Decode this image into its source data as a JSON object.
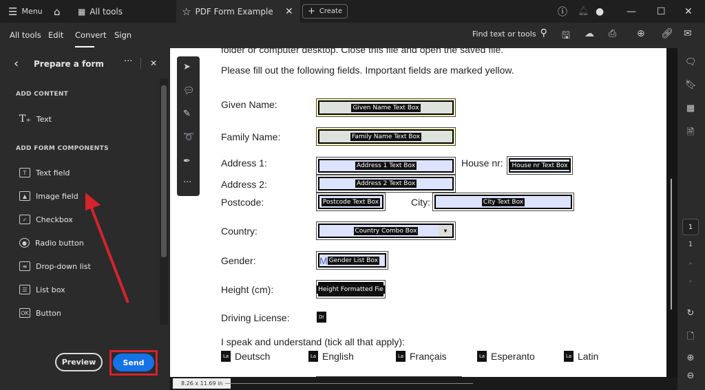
{
  "titlebar": {
    "menu": "Menu",
    "all_tools": "All tools",
    "tab_title": "PDF Form Example",
    "create": "Create"
  },
  "toolbar": {
    "nav": [
      "All tools",
      "Edit",
      "Convert",
      "Sign"
    ],
    "active": "Convert",
    "search": "Find text or tools"
  },
  "panel": {
    "title": "Prepare a form",
    "sections": [
      {
        "heading": "ADD CONTENT",
        "items": [
          {
            "label": "Text",
            "icon": "text-add-icon"
          }
        ]
      },
      {
        "heading": "ADD FORM COMPONENTS",
        "items": [
          {
            "label": "Text field",
            "icon": "text-field-icon"
          },
          {
            "label": "Image field",
            "icon": "image-icon"
          },
          {
            "label": "Checkbox",
            "icon": "checkbox-icon"
          },
          {
            "label": "Radio button",
            "icon": "radio-icon"
          },
          {
            "label": "Drop-down list",
            "icon": "dropdown-icon"
          },
          {
            "label": "List box",
            "icon": "listbox-icon"
          },
          {
            "label": "Button",
            "icon": "ok-button-icon"
          }
        ]
      }
    ],
    "preview": "Preview",
    "send": "Send",
    "send_color": "#1473e6",
    "highlight_color": "#d7232b"
  },
  "document": {
    "top_text": "folder or computer desktop. Close this file and open the saved file.",
    "intro": "Please fill out the following fields. Important fields are marked yellow.",
    "labels": {
      "given": "Given Name:",
      "family": "Family Name:",
      "addr1": "Address 1:",
      "house": "House nr:",
      "addr2": "Address 2:",
      "postcode": "Postcode:",
      "city": "City:",
      "country": "Country:",
      "gender": "Gender:",
      "height": "Height (cm):",
      "license": "Driving License:",
      "languages": "I speak and understand (tick all that apply):"
    },
    "fields": {
      "given": "Given Name Text Box",
      "family": "Family Name Text Box",
      "addr1": "Address 1 Text Box",
      "house": "House nr Text Box",
      "addr2": "Address 2 Text Box",
      "postcode": "Postcode Text Box",
      "city": "City Text Box",
      "country": "Country Combo Box",
      "gender": "Gender List Box",
      "gender_prefix": "M",
      "height": "Height Formatted Fie",
      "license": "Dr"
    },
    "language_options": [
      {
        "tag": "La",
        "label": "Deutsch"
      },
      {
        "tag": "La",
        "label": "English"
      },
      {
        "tag": "La",
        "label": "Français"
      },
      {
        "tag": "La",
        "label": "Esperanto"
      },
      {
        "tag": "La",
        "label": "Latin"
      }
    ]
  },
  "status": {
    "page_size": "8.26 x 11.69 in",
    "current_page": "1",
    "total_pages": "1"
  }
}
